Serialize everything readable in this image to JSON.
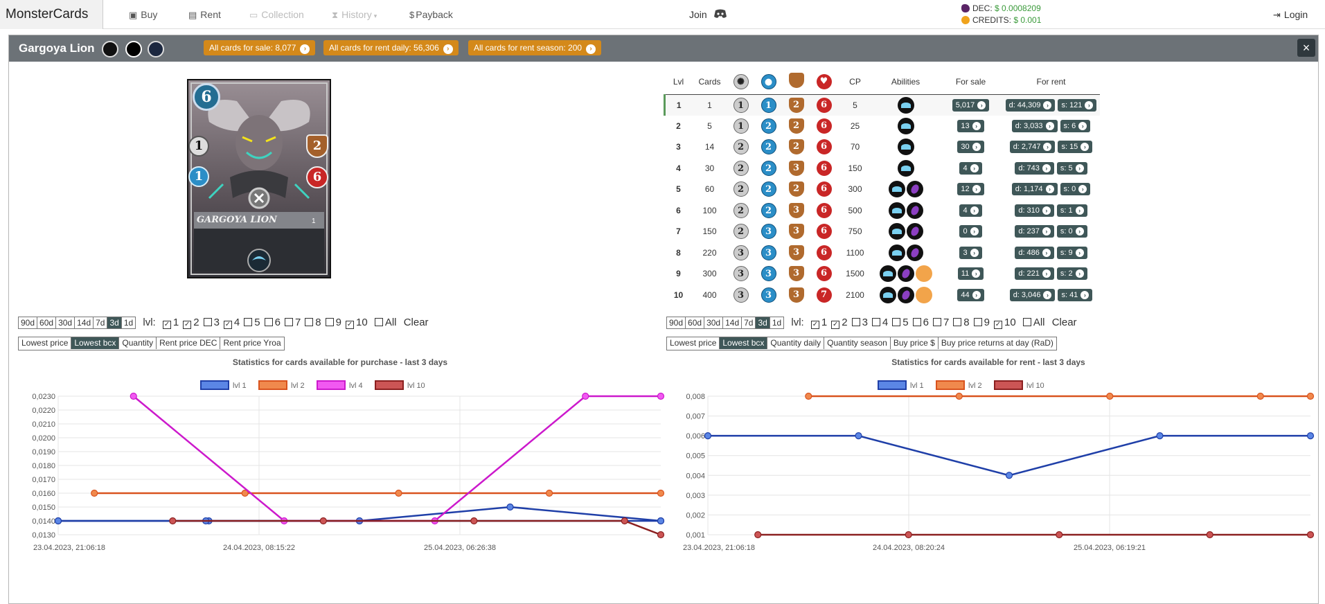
{
  "nav": {
    "brand": "MonsterCards",
    "items": [
      "Buy",
      "Rent",
      "Collection",
      "History",
      "Payback"
    ],
    "join": "Join",
    "login": "Login",
    "dec_label": "DEC:",
    "dec_value": "$ 0.0008209",
    "credits_label": "CREDITS:",
    "credits_value": "$ 0.001"
  },
  "card": {
    "name": "Gargoya Lion",
    "art_name": "GARGOYA LION",
    "mana": "6",
    "melee": "1",
    "speed": "1",
    "armor": "2",
    "health": "6",
    "level": "1",
    "badges": [
      "All cards for sale: 8,077",
      "All cards for rent daily: 56,306",
      "All cards for rent season: 200"
    ],
    "close": "×"
  },
  "table": {
    "headers": [
      "Lvl",
      "Cards",
      "CP",
      "Abilities",
      "For sale",
      "For rent"
    ],
    "rows": [
      {
        "lvl": "1",
        "cards": "1",
        "melee": "1",
        "speed": "1",
        "armor": "2",
        "health": "6",
        "cp": "5",
        "abil": [
          "a1"
        ],
        "sale": "5,017",
        "d": "d: 44,309",
        "s": "s: 121"
      },
      {
        "lvl": "2",
        "cards": "5",
        "melee": "1",
        "speed": "2",
        "armor": "2",
        "health": "6",
        "cp": "25",
        "abil": [
          "a1"
        ],
        "sale": "13",
        "d": "d: 3,033",
        "s": "s: 6"
      },
      {
        "lvl": "3",
        "cards": "14",
        "melee": "2",
        "speed": "2",
        "armor": "2",
        "health": "6",
        "cp": "70",
        "abil": [
          "a1"
        ],
        "sale": "30",
        "d": "d: 2,747",
        "s": "s: 15"
      },
      {
        "lvl": "4",
        "cards": "30",
        "melee": "2",
        "speed": "2",
        "armor": "3",
        "health": "6",
        "cp": "150",
        "abil": [
          "a1"
        ],
        "sale": "4",
        "d": "d: 743",
        "s": "s: 5"
      },
      {
        "lvl": "5",
        "cards": "60",
        "melee": "2",
        "speed": "2",
        "armor": "2",
        "health": "6",
        "cp": "300",
        "abil": [
          "a1",
          "a2"
        ],
        "sale": "12",
        "d": "d: 1,174",
        "s": "s: 0"
      },
      {
        "lvl": "6",
        "cards": "100",
        "melee": "2",
        "speed": "2",
        "armor": "3",
        "health": "6",
        "cp": "500",
        "abil": [
          "a1",
          "a2"
        ],
        "sale": "4",
        "d": "d: 310",
        "s": "s: 1"
      },
      {
        "lvl": "7",
        "cards": "150",
        "melee": "2",
        "speed": "3",
        "armor": "3",
        "health": "6",
        "cp": "750",
        "abil": [
          "a1",
          "a2"
        ],
        "sale": "0",
        "d": "d: 237",
        "s": "s: 0"
      },
      {
        "lvl": "8",
        "cards": "220",
        "melee": "3",
        "speed": "3",
        "armor": "3",
        "health": "6",
        "cp": "1100",
        "abil": [
          "a1",
          "a2"
        ],
        "sale": "3",
        "d": "d: 486",
        "s": "s: 9"
      },
      {
        "lvl": "9",
        "cards": "300",
        "melee": "3",
        "speed": "3",
        "armor": "3",
        "health": "6",
        "cp": "1500",
        "abil": [
          "a1",
          "a2",
          "a3"
        ],
        "sale": "11",
        "d": "d: 221",
        "s": "s: 2"
      },
      {
        "lvl": "10",
        "cards": "400",
        "melee": "3",
        "speed": "3",
        "armor": "3",
        "health": "7",
        "cp": "2100",
        "abil": [
          "a1",
          "a2",
          "a3"
        ],
        "sale": "44",
        "d": "d: 3,046",
        "s": "s: 41"
      }
    ]
  },
  "left_controls": {
    "periods": [
      "90d",
      "60d",
      "30d",
      "14d",
      "7d",
      "3d",
      "1d"
    ],
    "active_period": "3d",
    "lvl_label": "lvl:",
    "levels": [
      {
        "n": "1",
        "on": true
      },
      {
        "n": "2",
        "on": true
      },
      {
        "n": "3",
        "on": false
      },
      {
        "n": "4",
        "on": true
      },
      {
        "n": "5",
        "on": false
      },
      {
        "n": "6",
        "on": false
      },
      {
        "n": "7",
        "on": false
      },
      {
        "n": "8",
        "on": false
      },
      {
        "n": "9",
        "on": false
      },
      {
        "n": "10",
        "on": true
      }
    ],
    "all": "All",
    "clear": "Clear",
    "metrics": [
      "Lowest price",
      "Lowest bcx",
      "Quantity",
      "Rent price DEC",
      "Rent price Yroa"
    ],
    "active_metric": "Lowest bcx"
  },
  "right_controls": {
    "periods": [
      "90d",
      "60d",
      "30d",
      "14d",
      "7d",
      "3d",
      "1d"
    ],
    "active_period": "3d",
    "lvl_label": "lvl:",
    "levels": [
      {
        "n": "1",
        "on": true
      },
      {
        "n": "2",
        "on": true
      },
      {
        "n": "3",
        "on": false
      },
      {
        "n": "4",
        "on": false
      },
      {
        "n": "5",
        "on": false
      },
      {
        "n": "6",
        "on": false
      },
      {
        "n": "7",
        "on": false
      },
      {
        "n": "8",
        "on": false
      },
      {
        "n": "9",
        "on": false
      },
      {
        "n": "10",
        "on": true
      }
    ],
    "all": "All",
    "clear": "Clear",
    "metrics": [
      "Lowest price",
      "Lowest bcx",
      "Quantity daily",
      "Quantity season",
      "Buy price $",
      "Buy price returns at day (RaD)"
    ],
    "active_metric": "Lowest bcx"
  },
  "chart_data": [
    {
      "type": "line",
      "title": "Statistics for cards available for purchase - last 3 days",
      "x_ticks": [
        "23.04.2023, 21:06:18",
        "24.04.2023, 08:15:22",
        "25.04.2023, 06:26:38"
      ],
      "y_ticks": [
        "0,0230",
        "0,0220",
        "0,0210",
        "0,0200",
        "0,0190",
        "0,0180",
        "0,0170",
        "0,0160",
        "0,0150",
        "0,0140",
        "0,0130"
      ],
      "ylim": [
        0.013,
        0.023
      ],
      "x_range": [
        0,
        100
      ],
      "grid": true,
      "legend": "top-center",
      "series": [
        {
          "name": "lvl 1",
          "color": "#1f3fa8",
          "fill": "#5b86e5",
          "x": [
            0,
            25,
            50,
            100
          ],
          "y": [
            0.014,
            0.014,
            0.014,
            0.014
          ]
        },
        {
          "name": "lvl 1",
          "color": "#1f3fa8",
          "fill": "#5b86e5",
          "x": [
            0,
            24.5,
            50,
            75,
            100
          ],
          "y": [
            0.014,
            0.014,
            0.014,
            0.015,
            0.014
          ]
        },
        {
          "name": "lvl 2",
          "color": "#d9531e",
          "fill": "#f0894d",
          "x": [
            6,
            31,
            56.5,
            81.5,
            100
          ],
          "y": [
            0.016,
            0.016,
            0.016,
            0.016,
            0.016
          ]
        },
        {
          "name": "lvl 4",
          "color": "#cc19cc",
          "fill": "#f159f1",
          "x": [
            12.5,
            37.5,
            62.5,
            87.5,
            100
          ],
          "y": [
            0.023,
            0.014,
            0.014,
            0.023,
            0.023
          ]
        },
        {
          "name": "lvl 10",
          "color": "#8b2020",
          "fill": "#cc5555",
          "x": [
            19,
            44,
            69,
            94,
            100
          ],
          "y": [
            0.014,
            0.014,
            0.014,
            0.014,
            0.013
          ]
        }
      ]
    },
    {
      "type": "line",
      "title": "Statistics for cards available for rent - last 3 days",
      "x_ticks": [
        "23.04.2023, 21:06:18",
        "24.04.2023, 08:20:24",
        "25.04.2023, 06:19:21"
      ],
      "y_ticks": [
        "0,008",
        "0,007",
        "0,006",
        "0,005",
        "0,004",
        "0,003",
        "0,002",
        "0,001"
      ],
      "ylim": [
        0.001,
        0.008
      ],
      "x_range": [
        0,
        100
      ],
      "grid": true,
      "legend": "top-center",
      "series": [
        {
          "name": "lvl 1",
          "color": "#1f3fa8",
          "fill": "#5b86e5",
          "x": [
            0,
            25,
            50,
            75,
            100
          ],
          "y": [
            0.006,
            0.006,
            0.004,
            0.006,
            0.006
          ]
        },
        {
          "name": "lvl 2",
          "color": "#d9531e",
          "fill": "#f0894d",
          "x": [
            16.7,
            41.7,
            66.7,
            91.7,
            100
          ],
          "y": [
            0.008,
            0.008,
            0.008,
            0.008,
            0.008
          ]
        },
        {
          "name": "lvl 10",
          "color": "#8b2020",
          "fill": "#cc5555",
          "x": [
            8.3,
            33.3,
            58.3,
            83.3,
            100
          ],
          "y": [
            0.001,
            0.001,
            0.001,
            0.001,
            0.001
          ]
        }
      ]
    }
  ]
}
